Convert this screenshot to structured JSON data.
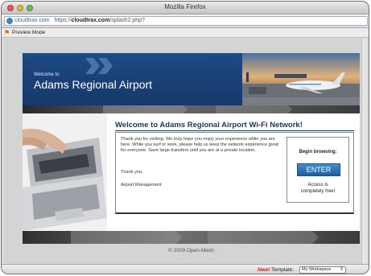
{
  "window": {
    "title": "Mozilla Firefox"
  },
  "urlbar": {
    "site": "cloudtrax.com",
    "prefix": "https://",
    "host": "cloudtrax.com",
    "path": "/splash2.php?"
  },
  "preview": {
    "label": "Preview Mode"
  },
  "header": {
    "welcome_to": "Welcome to",
    "airport_name": "Adams Regional Airport"
  },
  "main": {
    "title": "Welcome to Adams Regional Airport Wi-Fi Network!",
    "paragraph": "Thank you for visiting. We truly hope you enjoy your experience while you are here. While you surf or work, please help us keep the network experience great for everyone. Save large transfers until you are at a private location.",
    "thanks": "Thank you,",
    "signoff": "Airport Management"
  },
  "browse": {
    "label": "Begin browsing:",
    "button": "ENTER",
    "access_line1": "Access is",
    "access_line2": "completely free!"
  },
  "footer": {
    "copyright": "© 2009 Open-Mesh"
  },
  "bottombar": {
    "new": "New!",
    "template_label": "Template:",
    "template_value": "My Workspace",
    "select_arrow": "⇕"
  },
  "colors": {
    "header_blue": "#1e4a84",
    "title_navy": "#1e3655",
    "enter_blue": "#2f7bc0",
    "new_red": "#d0201b"
  },
  "icons": {
    "site": "globe-icon",
    "preview": "preview-mode-icon",
    "dropdown": "updown-arrow-icon"
  }
}
